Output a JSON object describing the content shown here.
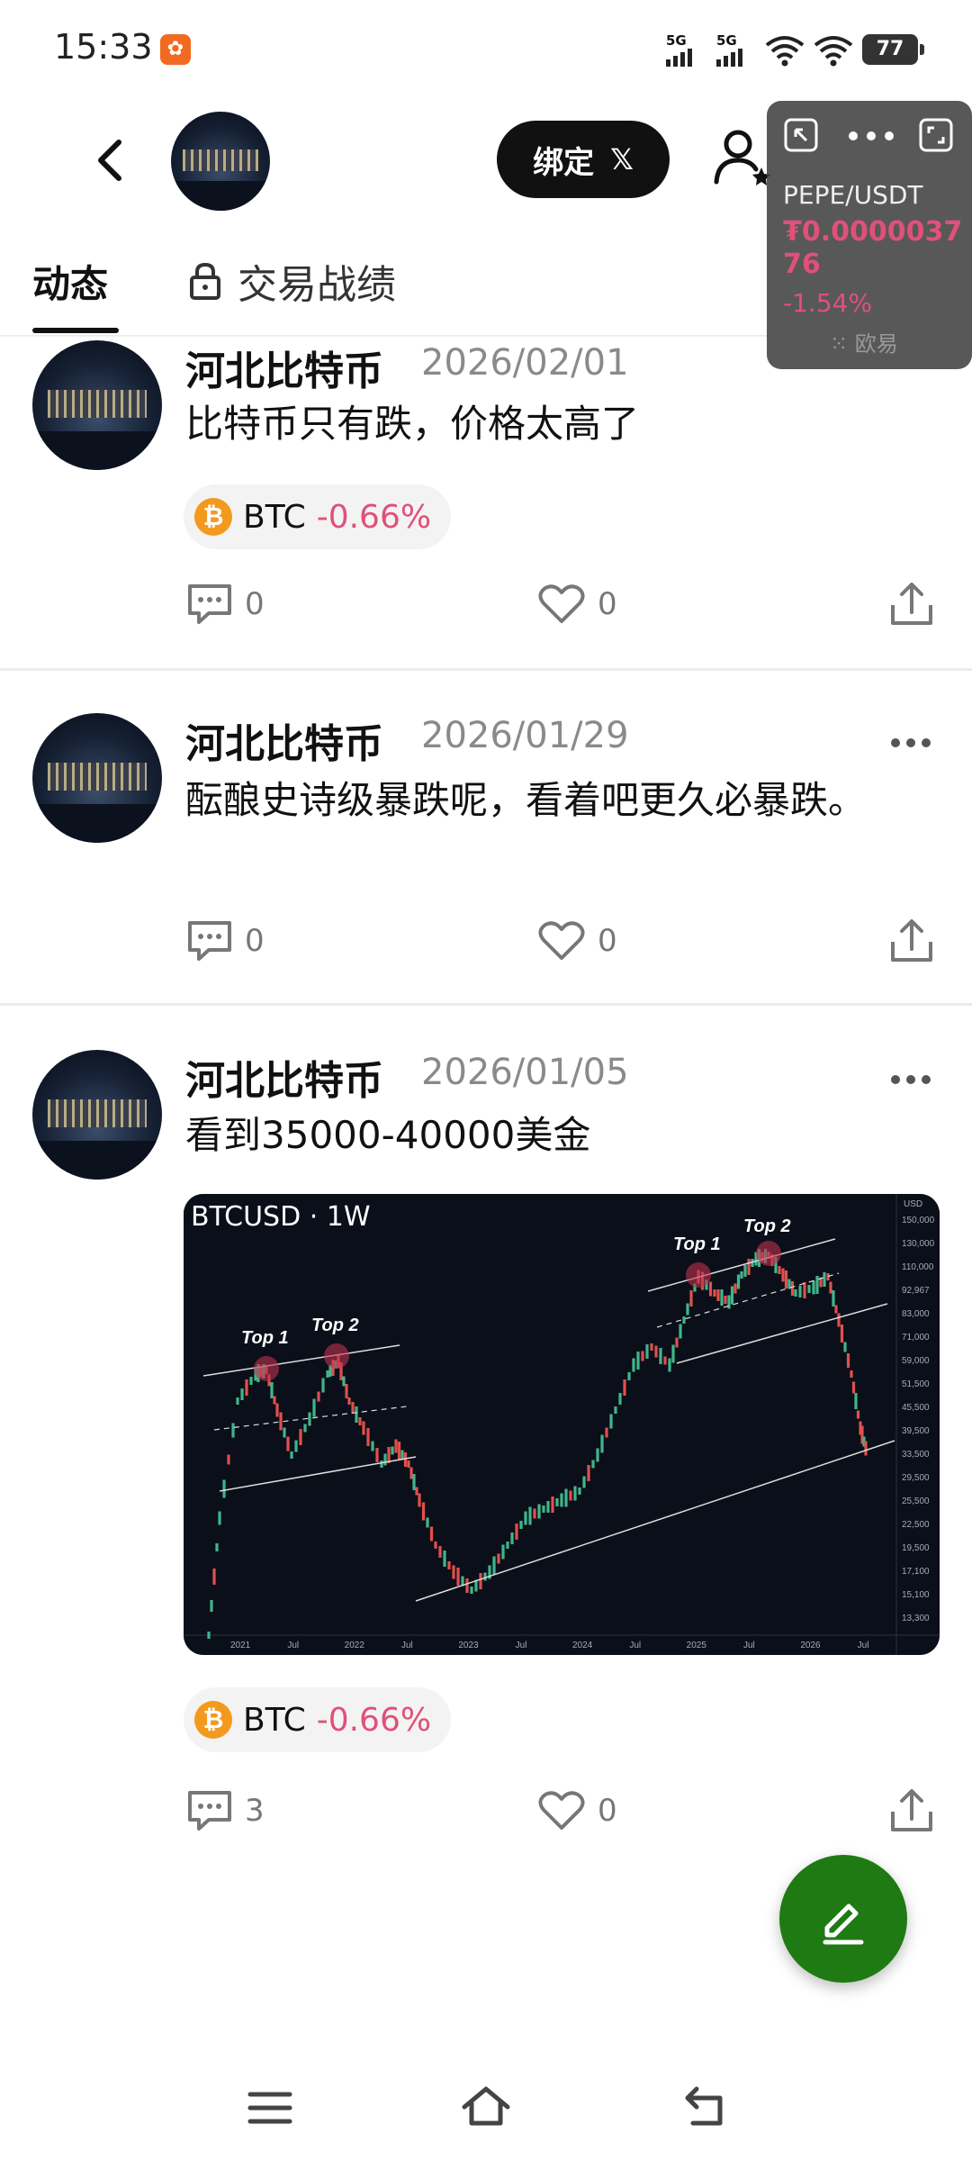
{
  "status_bar": {
    "time": "15:33",
    "signal_1": "5G",
    "signal_2": "5G",
    "battery": "77"
  },
  "header": {
    "bind_label": "绑定",
    "bind_brand": "𝕏"
  },
  "tabs": {
    "active": "动态",
    "locked": "交易战绩"
  },
  "ticker": {
    "pair": "PEPE/USDT",
    "price": "₮0.000003776",
    "change": "-1.54%",
    "watermark": "欧易"
  },
  "posts": [
    {
      "author": "河北比特币",
      "date": "2026/02/01",
      "content": "比特币只有跌，价格太高了",
      "tag": {
        "symbol": "BTC",
        "change": "-0.66%"
      },
      "comments": "0",
      "likes": "0"
    },
    {
      "author": "河北比特币",
      "date": "2026/01/29",
      "content": "酝酿史诗级暴跌呢，看着吧更久必暴跌。",
      "comments": "0",
      "likes": "0"
    },
    {
      "author": "河北比特币",
      "date": "2026/01/05",
      "content": "看到35000-40000美金",
      "tag": {
        "symbol": "BTC",
        "change": "-0.66%"
      },
      "comments": "3",
      "likes": "0",
      "image": {
        "title": "BTCUSD · 1W",
        "currency": "USD",
        "top_labels": [
          "Top 1",
          "Top 2",
          "Top 1",
          "Top 2"
        ],
        "price_ticks": [
          "150,000",
          "130,000",
          "110,000",
          "92,967",
          "83,000",
          "71,000",
          "59,000",
          "51,500",
          "45,500",
          "39,500",
          "33,500",
          "29,500",
          "25,500",
          "22,500",
          "19,500",
          "17,100",
          "15,100",
          "13,300"
        ],
        "time_ticks": [
          "2021",
          "Jul",
          "2022",
          "Jul",
          "2023",
          "Jul",
          "2024",
          "Jul",
          "2025",
          "Jul",
          "2026",
          "Jul"
        ]
      }
    }
  ],
  "colors": {
    "negative": "#e0507a",
    "fab": "#1f7a14",
    "coin": "#f39a1e"
  }
}
